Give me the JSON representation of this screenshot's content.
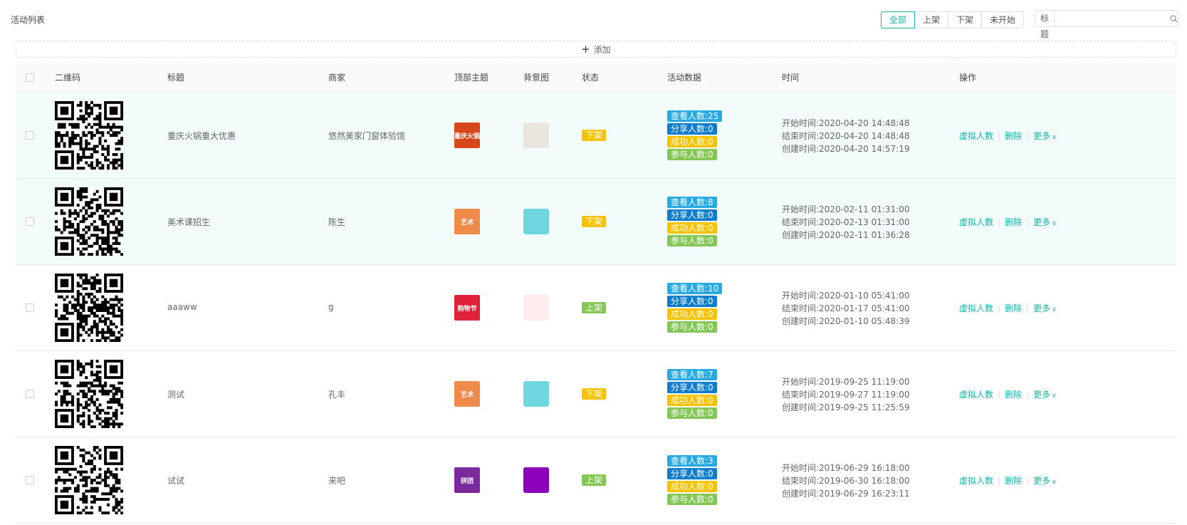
{
  "page": {
    "title": "活动列表"
  },
  "filters": [
    "全部",
    "上架",
    "下架",
    "未开始"
  ],
  "search": {
    "field": "标题",
    "placeholder": ""
  },
  "add": {
    "label": "添加"
  },
  "columns": [
    "二维码",
    "标题",
    "商家",
    "顶部主题",
    "背景图",
    "状态",
    "活动数据",
    "时间",
    "操作"
  ],
  "labels": {
    "view": "查看人数:",
    "share": "分享人数:",
    "success": "成功人数:",
    "join": "参与人数:",
    "start": "开始时间:",
    "end": "结束时间:",
    "created": "创建时间:"
  },
  "actions": {
    "virtual": "虚拟人数",
    "delete": "删除",
    "more": "更多"
  },
  "colors": {
    "accent": "#17b3a3",
    "status_off": "#f7c300",
    "status_on": "#84c756"
  },
  "rows": [
    {
      "title": "重庆火锅重大优惠",
      "merchant": "悠然美家门窗体验馆",
      "theme_text": "重庆火锅",
      "theme_color": "#d8461c",
      "bg_color": "#ebe5df",
      "status": "下架",
      "status_color": "#f7c300",
      "view": "查看人数:25",
      "share": "分享人数:0",
      "success": "成功人数:0",
      "join": "参与人数:0",
      "start": "开始时间:2020-04-20 14:48:48",
      "end": "结束时间:2020-04-20 14:48:48",
      "created": "创建时间:2020-04-20 14:57:19",
      "highlight": true
    },
    {
      "title": "美术课招生",
      "merchant": "陈生",
      "theme_text": "艺术",
      "theme_color": "#f08a4b",
      "bg_color": "#6dd6de",
      "status": "下架",
      "status_color": "#f7c300",
      "view": "查看人数:8",
      "share": "分享人数:0",
      "success": "成功人数:0",
      "join": "参与人数:0",
      "start": "开始时间:2020-02-11 01:31:00",
      "end": "结束时间:2020-02-13 01:31:00",
      "created": "创建时间:2020-02-11 01:36:28",
      "highlight": true
    },
    {
      "title": "aaaww",
      "merchant": "g",
      "theme_text": "购物节",
      "theme_color": "#e0213a",
      "bg_color": "#fdeceb",
      "status": "上架",
      "status_color": "#84c756",
      "view": "查看人数:10",
      "share": "分享人数:0",
      "success": "成功人数:0",
      "join": "参与人数:0",
      "start": "开始时间:2020-01-10 05:41:00",
      "end": "结束时间:2020-01-17 05:41:00",
      "created": "创建时间:2020-01-10 05:48:39",
      "highlight": false
    },
    {
      "title": "测试",
      "merchant": "孔丰",
      "theme_text": "艺术",
      "theme_color": "#f08a4b",
      "bg_color": "#6dd6de",
      "status": "下架",
      "status_color": "#f7c300",
      "view": "查看人数:7",
      "share": "分享人数:0",
      "success": "成功人数:0",
      "join": "参与人数:0",
      "start": "开始时间:2019-09-25 11:19:00",
      "end": "结束时间:2019-09-27 11:19:00",
      "created": "创建时间:2019-09-25 11:25:59",
      "highlight": false
    },
    {
      "title": "试试",
      "merchant": "来吧",
      "theme_text": "拼团",
      "theme_color": "#7b2a9e",
      "bg_color": "#8b00b8",
      "status": "上架",
      "status_color": "#84c756",
      "view": "查看人数:3",
      "share": "分享人数:0",
      "success": "成功人数:0",
      "join": "参与人数:0",
      "start": "开始时间:2019-06-29 16:18:00",
      "end": "结束时间:2019-06-30 16:18:00",
      "created": "创建时间:2019-06-29 16:23:11",
      "highlight": false
    }
  ]
}
